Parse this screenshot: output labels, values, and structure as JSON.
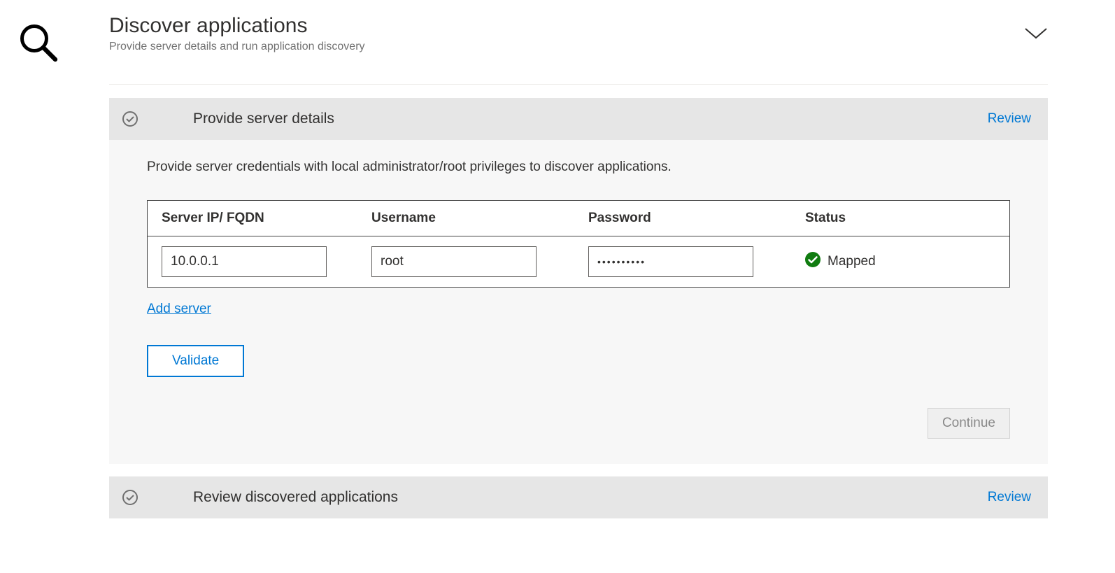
{
  "header": {
    "title": "Discover applications",
    "subtitle": "Provide server details and run application discovery"
  },
  "steps": [
    {
      "title": "Provide server details",
      "link_label": "Review"
    },
    {
      "title": "Review discovered applications",
      "link_label": "Review"
    }
  ],
  "panel": {
    "description": "Provide server credentials with local administrator/root privileges to discover applications.",
    "columns": {
      "ip": "Server IP/ FQDN",
      "username": "Username",
      "password": "Password",
      "status": "Status"
    },
    "rows": [
      {
        "ip": "10.0.0.1",
        "username": "root",
        "password_mask": "••••••••••",
        "status_label": "Mapped"
      }
    ],
    "add_server_label": "Add server",
    "validate_label": "Validate",
    "continue_label": "Continue"
  },
  "icons": {
    "search": "search-icon",
    "chevron": "chevron-down-icon",
    "check_ring": "check-ring-icon",
    "success": "success-check-icon"
  },
  "colors": {
    "link": "#0078d4",
    "success": "#107c10"
  }
}
